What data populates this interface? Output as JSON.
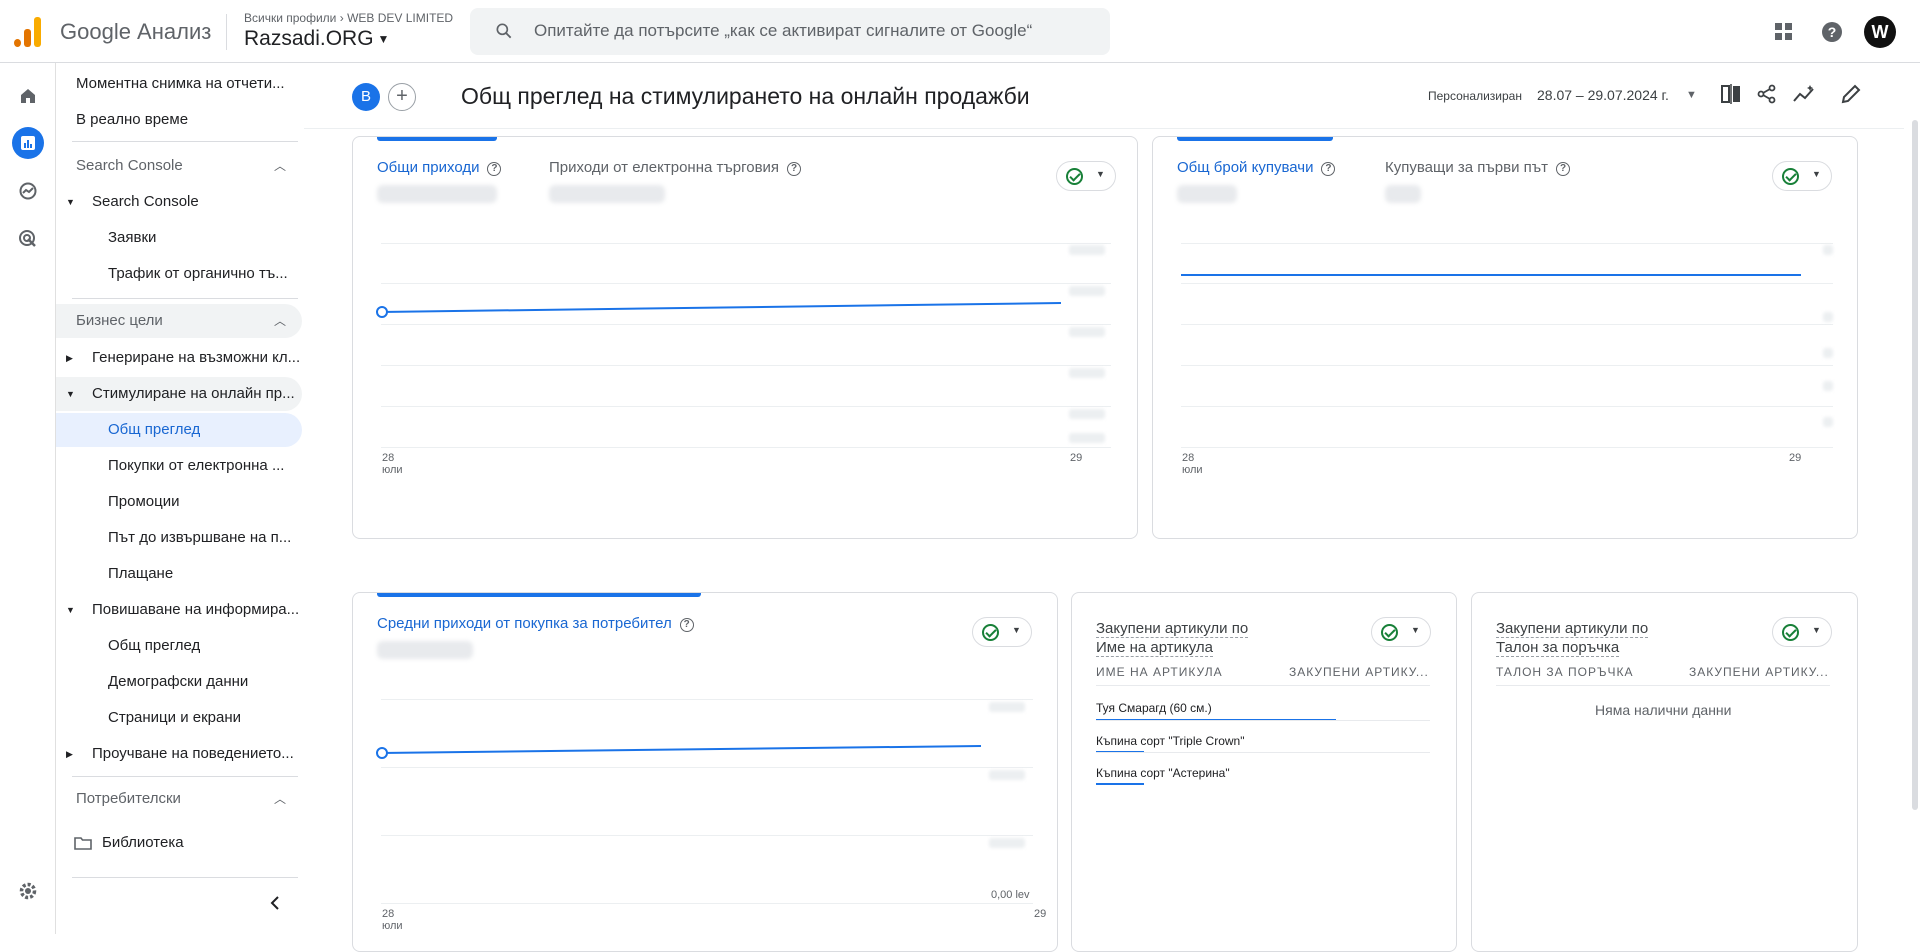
{
  "app": {
    "name": "Google Анализ",
    "breadcrumb_root": "Всички профили",
    "breadcrumb_account": "WEB DEV LIMITED",
    "property": "Razsadi.ORG",
    "search_placeholder": "Опитайте да потърсите „как се активират сигналите от Google“",
    "avatar_letter": "W"
  },
  "nav": {
    "snapshot": "Моментна снимка на отчети...",
    "realtime": "В реално време",
    "section_search_console": "Search Console",
    "search_console": "Search Console",
    "queries": "Заявки",
    "organic": "Трафик от органично тъ...",
    "section_business": "Бизнес цели",
    "leads": "Генериране на възможни кл...",
    "sales": "Стимулиране на онлайн пр...",
    "overview": "Общ преглед",
    "ecommerce": "Покупки от електронна ...",
    "promotions": "Промоции",
    "purchase_path": "Път до извършване на п...",
    "checkout": "Плащане",
    "awareness": "Повишаване на информира...",
    "awareness_overview": "Общ преглед",
    "demographics": "Демографски данни",
    "pages": "Страници и екрани",
    "behavior": "Проучване на поведението...",
    "section_user": "Потребителски",
    "library": "Библиотека"
  },
  "header": {
    "badge": "В",
    "title": "Общ преглед на стимулирането на онлайн продажби",
    "period_label": "Персонализиран",
    "date_range": "28.07 – 29.07.2024 г."
  },
  "card1": {
    "metric1": "Общи приходи",
    "metric2": "Приходи от електронна търговия",
    "x_start": "28",
    "x_start_month": "юли",
    "x_end": "29"
  },
  "card2": {
    "metric1": "Общ брой купувачи",
    "metric2": "Купуващи за първи път",
    "x_start": "28",
    "x_start_month": "юли",
    "x_end": "29"
  },
  "card3": {
    "metric1": "Средни приходи от покупка за потребител",
    "y_min_label": "0,00 lev",
    "x_start": "28",
    "x_start_month": "юли",
    "x_end": "29"
  },
  "card4": {
    "title_line1": "Закупени артикули по",
    "title_line2": "Име на артикула",
    "col1": "ИМЕ НА АРТИКУЛА",
    "col2": "ЗАКУПЕНИ АРТИКУ...",
    "rows": [
      "Туя Смарагд (60 см.)",
      "Къпина сорт \"Triple Crown\"",
      "Къпина сорт \"Астерина\""
    ],
    "row_share": [
      1.0,
      0.2,
      0.2
    ]
  },
  "card5": {
    "title_line1": "Закупени артикули по",
    "title_line2": "Талон за поръчка",
    "col1": "ТАЛОН ЗА ПОРЪЧКА",
    "col2": "ЗАКУПЕНИ АРТИКУ...",
    "empty": "Няма налични данни"
  },
  "colors": {
    "accent": "#1a73e8",
    "check": "#188038"
  }
}
